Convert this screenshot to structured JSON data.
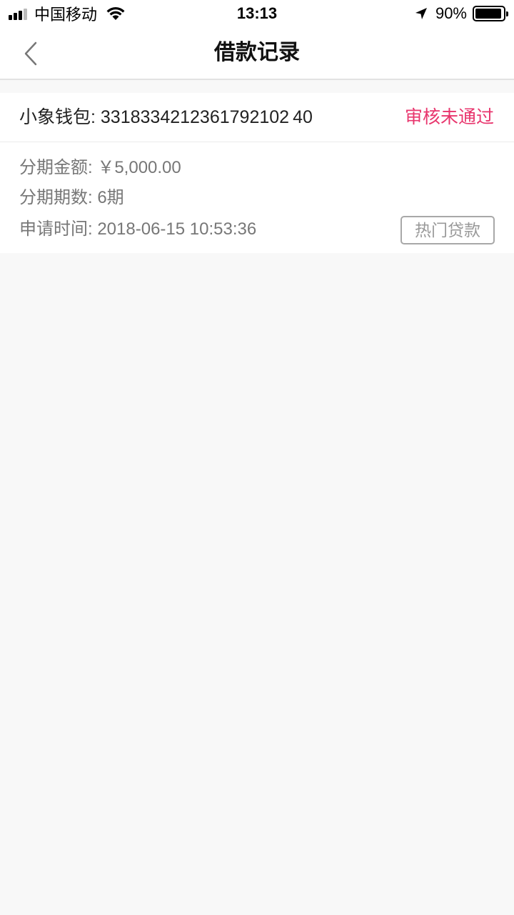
{
  "status_bar": {
    "carrier": "中国移动",
    "time": "13:13",
    "battery_percent": "90%",
    "battery_level": 0.9,
    "signal_bars": 4,
    "signal_bars_filled": 3
  },
  "nav": {
    "title": "借款记录",
    "back_icon": "chevron-left-icon"
  },
  "record": {
    "wallet_label": "小象钱包: 3318334212361792102 40",
    "status": "审核未通过",
    "status_color": "#e8356d",
    "amount_label": "分期金额: ￥5,000.00",
    "periods_label": "分期期数: 6期",
    "time_label": "申请时间: 2018-06-15 10:53:36",
    "action_button": "热门贷款"
  },
  "colors": {
    "background": "#f8f8f8",
    "card": "#ffffff",
    "accent_status": "#e8356d"
  }
}
